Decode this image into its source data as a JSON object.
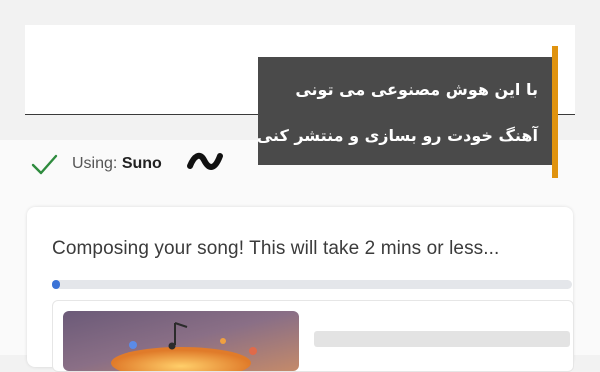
{
  "status": {
    "prefix": "Using:",
    "service": "Suno"
  },
  "icons": {
    "check": "check-icon",
    "logo": "suno-logo-icon"
  },
  "card": {
    "message": "Composing your song! This will take 2 mins or less...",
    "progress": 0.01
  },
  "banner": {
    "line1": "با این هوش مصنوعی می تونی",
    "line2": "آهنگ خودت رو بسازی و منتشر کنی"
  },
  "colors": {
    "check": "#2e8b3e",
    "progress": "#3b73d6",
    "banner_bg": "#4a4a4a",
    "banner_accent": "#e0930f"
  }
}
